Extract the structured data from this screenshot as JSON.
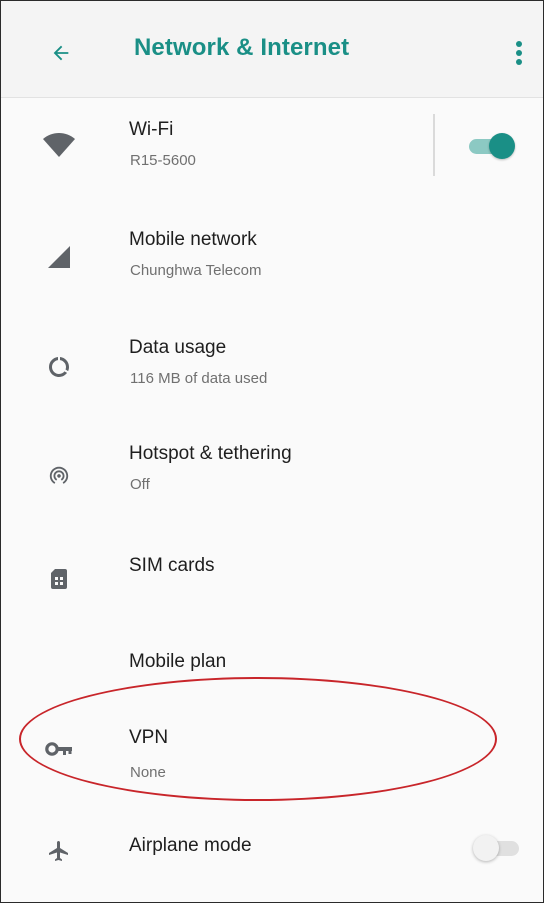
{
  "appbar": {
    "title": "Network & Internet",
    "back_icon": "arrow-back-icon",
    "menu_icon": "more-vert-icon"
  },
  "colors": {
    "accent": "#1a8f86",
    "icon": "#5f6368",
    "highlight": "#c8252a"
  },
  "items": [
    {
      "id": "wifi",
      "icon": "wifi-icon",
      "title": "Wi-Fi",
      "subtitle": "R15-5600",
      "toggle": true
    },
    {
      "id": "mobile-network",
      "icon": "cell-signal-icon",
      "title": "Mobile network",
      "subtitle": "Chunghwa Telecom"
    },
    {
      "id": "data-usage",
      "icon": "data-usage-icon",
      "title": "Data usage",
      "subtitle": "116 MB of data used"
    },
    {
      "id": "hotspot",
      "icon": "hotspot-icon",
      "title": "Hotspot & tethering",
      "subtitle": "Off"
    },
    {
      "id": "sim-cards",
      "icon": "sim-card-icon",
      "title": "SIM cards"
    },
    {
      "id": "mobile-plan",
      "title": "Mobile plan"
    },
    {
      "id": "vpn",
      "icon": "vpn-key-icon",
      "title": "VPN",
      "subtitle": "None",
      "highlighted": true
    },
    {
      "id": "airplane-mode",
      "icon": "airplane-icon",
      "title": "Airplane mode",
      "toggle": false
    }
  ]
}
